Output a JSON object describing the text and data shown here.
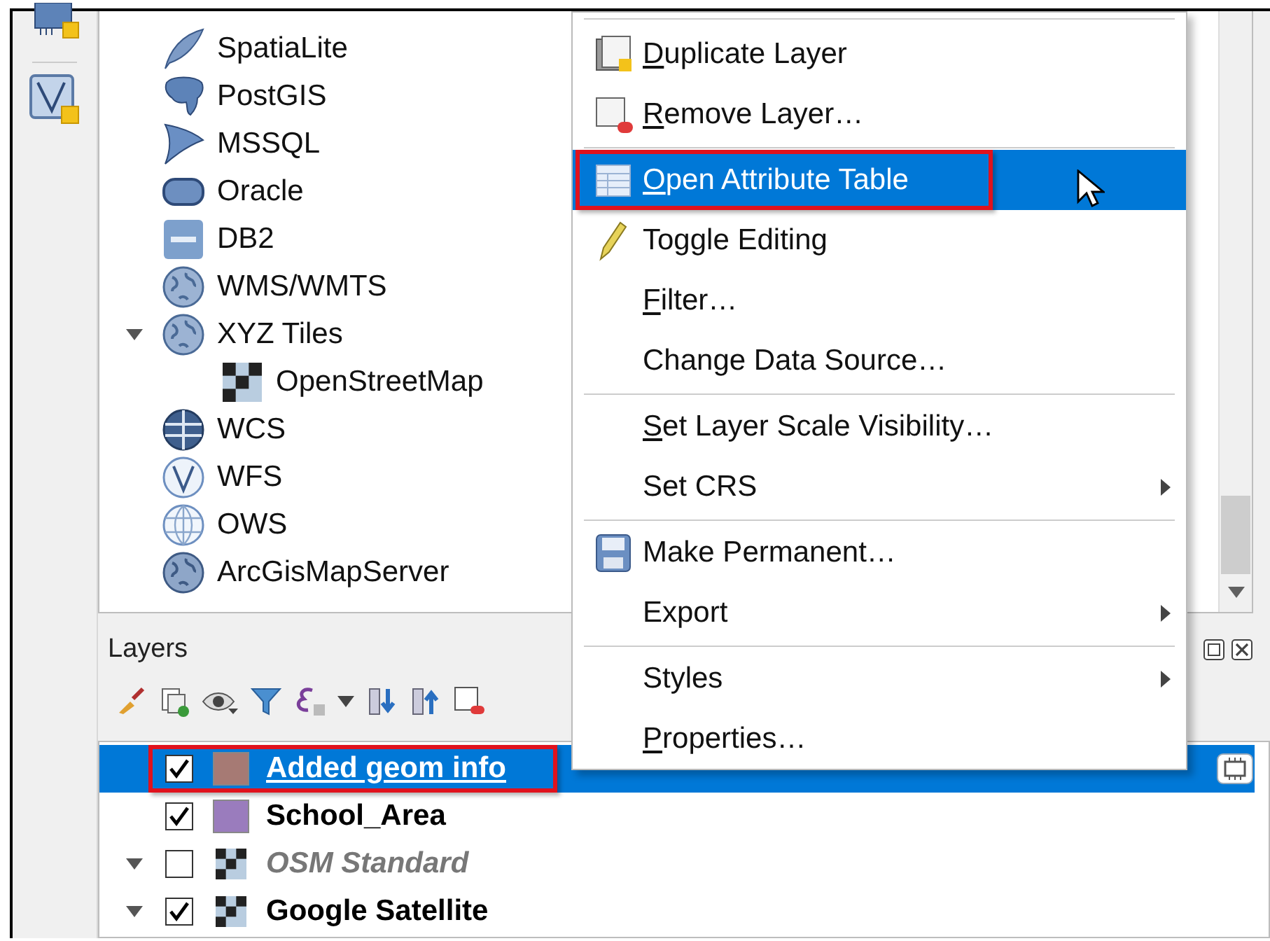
{
  "browser": {
    "items": [
      {
        "label": "SpatiaLite"
      },
      {
        "label": "PostGIS"
      },
      {
        "label": "MSSQL"
      },
      {
        "label": "Oracle"
      },
      {
        "label": "DB2"
      },
      {
        "label": "WMS/WMTS"
      },
      {
        "label": "XYZ Tiles",
        "expanded": true,
        "children": [
          {
            "label": "OpenStreetMap"
          }
        ]
      },
      {
        "label": "WCS"
      },
      {
        "label": "WFS"
      },
      {
        "label": "OWS"
      },
      {
        "label": "ArcGisMapServer"
      }
    ]
  },
  "layers": {
    "title": "Layers",
    "items": [
      {
        "name": "Added geom info",
        "kind": "vector",
        "color": "#a67a74",
        "checked": true,
        "selected": true,
        "annotated": true,
        "indicator": true
      },
      {
        "name": "School_Area",
        "kind": "vector",
        "color": "#9a7cbd",
        "checked": true,
        "selected": false,
        "annotated": false,
        "indicator": false
      },
      {
        "name": "OSM Standard",
        "kind": "tiles",
        "expanded": true,
        "checked": false,
        "selected": false,
        "annotated": false,
        "indicator": false
      },
      {
        "name": "Google Satellite",
        "kind": "tiles",
        "expanded": true,
        "checked": true,
        "selected": false,
        "annotated": false,
        "indicator": false
      }
    ]
  },
  "context_menu": {
    "items": [
      {
        "kind": "separator"
      },
      {
        "kind": "item",
        "label": "Duplicate Layer",
        "mnemonic": true,
        "submenu": false,
        "selected": false,
        "annotated": false
      },
      {
        "kind": "item",
        "label": "Remove Layer…",
        "mnemonic": true,
        "submenu": false,
        "selected": false,
        "annotated": false
      },
      {
        "kind": "separator"
      },
      {
        "kind": "item",
        "label": "Open Attribute Table",
        "mnemonic": true,
        "submenu": false,
        "selected": true,
        "annotated": true
      },
      {
        "kind": "item",
        "label": "Toggle Editing",
        "mnemonic": false,
        "submenu": false,
        "selected": false,
        "annotated": false
      },
      {
        "kind": "item",
        "label": "Filter…",
        "mnemonic": true,
        "submenu": false,
        "selected": false,
        "annotated": false
      },
      {
        "kind": "item",
        "label": "Change Data Source…",
        "mnemonic": false,
        "submenu": false,
        "selected": false,
        "annotated": false
      },
      {
        "kind": "separator"
      },
      {
        "kind": "item",
        "label": "Set Layer Scale Visibility…",
        "mnemonic": true,
        "submenu": false,
        "selected": false,
        "annotated": false
      },
      {
        "kind": "item",
        "label": "Set CRS",
        "mnemonic": false,
        "submenu": true,
        "selected": false,
        "annotated": false
      },
      {
        "kind": "separator"
      },
      {
        "kind": "item",
        "label": "Make Permanent…",
        "mnemonic": false,
        "submenu": false,
        "selected": false,
        "annotated": false
      },
      {
        "kind": "item",
        "label": "Export",
        "mnemonic": false,
        "submenu": true,
        "selected": false,
        "annotated": false
      },
      {
        "kind": "separator"
      },
      {
        "kind": "item",
        "label": "Styles",
        "mnemonic": false,
        "submenu": true,
        "selected": false,
        "annotated": false
      },
      {
        "kind": "item",
        "label": "Properties…",
        "mnemonic": true,
        "submenu": false,
        "selected": false,
        "annotated": false
      }
    ]
  }
}
